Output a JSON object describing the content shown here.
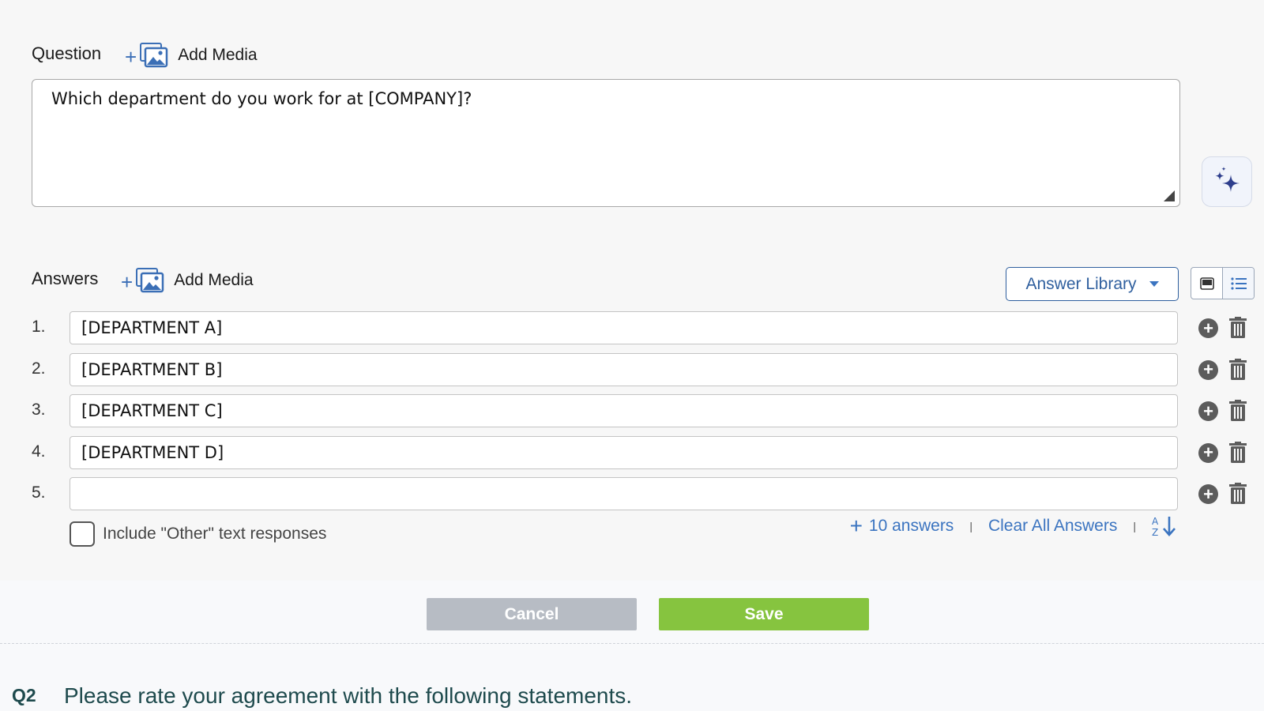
{
  "question": {
    "heading": "Question",
    "add_media_label": "Add Media",
    "text": "Which department do you work for at [COMPANY]?"
  },
  "answers": {
    "heading": "Answers",
    "add_media_label": "Add Media",
    "library_label": "Answer Library",
    "items": [
      {
        "num": "1.",
        "value": "[DEPARTMENT A]"
      },
      {
        "num": "2.",
        "value": "[DEPARTMENT B]"
      },
      {
        "num": "3.",
        "value": "[DEPARTMENT C]"
      },
      {
        "num": "4.",
        "value": "[DEPARTMENT D]"
      },
      {
        "num": "5.",
        "value": ""
      }
    ],
    "other_label": "Include \"Other\" text responses",
    "add_answers_label": "10 answers",
    "clear_label": "Clear All Answers"
  },
  "footer": {
    "cancel_label": "Cancel",
    "save_label": "Save"
  },
  "next_question": {
    "number": "Q2",
    "text": "Please rate your agreement with the following statements."
  },
  "colors": {
    "accent": "#3b74c0",
    "save": "#86c43f",
    "cancel": "#b7bcc4",
    "question_text": "#1e4a4d"
  }
}
